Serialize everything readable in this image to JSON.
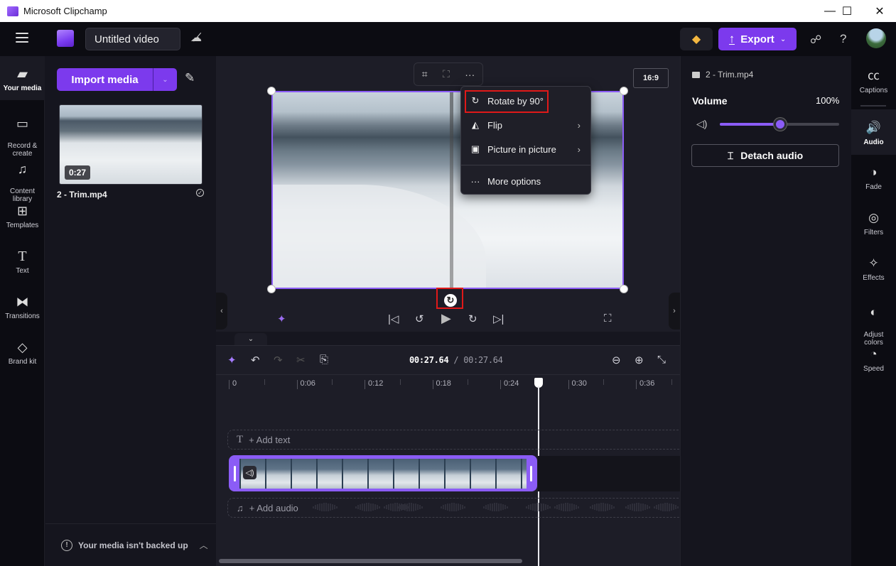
{
  "window": {
    "title": "Microsoft Clipchamp",
    "controls": {
      "minimize": "—",
      "maximize": "☐",
      "close": "✕"
    }
  },
  "appbar": {
    "project_title": "Untitled video",
    "export_label": "Export",
    "icons": {
      "menu": "≡",
      "cloud_off": "☁̸",
      "premium": "◆",
      "share": "☍",
      "help": "?"
    }
  },
  "left_rail": {
    "items": [
      {
        "label": "Your media",
        "icon": "▰",
        "active": true
      },
      {
        "label": "Record &\ncreate",
        "icon": "▭"
      },
      {
        "label": "Content\nlibrary",
        "icon": "♫"
      },
      {
        "label": "Templates",
        "icon": "⊞"
      },
      {
        "label": "Text",
        "icon": "T"
      },
      {
        "label": "Transitions",
        "icon": "⧓"
      },
      {
        "label": "Brand kit",
        "icon": "◇"
      }
    ]
  },
  "media_panel": {
    "import_label": "Import media",
    "items": [
      {
        "name": "2 - Trim.mp4",
        "duration": "0:27",
        "status": "✓"
      }
    ],
    "backup_notice": "Your media isn't backed up"
  },
  "preview": {
    "aspect_ratio": "16:9",
    "toolbar": {
      "crop": "⌗",
      "fit": "⛶",
      "more": "···"
    },
    "context_menu": {
      "items": [
        {
          "label": "Rotate by 90°",
          "icon": "↻",
          "highlighted": true
        },
        {
          "label": "Flip",
          "icon": "◭",
          "submenu": true
        },
        {
          "label": "Picture in picture",
          "icon": "▣",
          "submenu": true
        },
        {
          "label": "More options",
          "icon": "···"
        }
      ]
    },
    "rotate_handle_icon": "↻",
    "playback": {
      "skip_start": "|◁",
      "back5": "↺",
      "play": "▶",
      "fwd5": "↻",
      "skip_end": "▷|",
      "fullscreen": "⛶",
      "ai": "✦"
    }
  },
  "timeline": {
    "current_time": "00:27.64",
    "total_time": "/ 00:27.64",
    "ruler_labels": [
      "0",
      "0:06",
      "0:12",
      "0:18",
      "0:24",
      "0:30",
      "0:36"
    ],
    "playhead_seconds": 27.64,
    "add_text_label": "+ Add text",
    "add_audio_label": "+ Add audio",
    "collapse_icon": "⌄"
  },
  "properties": {
    "file_name": "2 - Trim.mp4",
    "volume_label": "Volume",
    "volume_value": "100%",
    "volume_fraction": 0.5,
    "detach_label": "Detach audio"
  },
  "right_rail": {
    "items": [
      {
        "label": "Captions",
        "icon": "㏄"
      },
      {
        "label": "Audio",
        "icon": "🔊",
        "active": true
      },
      {
        "label": "Fade",
        "icon": "◑"
      },
      {
        "label": "Filters",
        "icon": "◎"
      },
      {
        "label": "Effects",
        "icon": "✧"
      },
      {
        "label": "Adjust\ncolors",
        "icon": "◐"
      },
      {
        "label": "Speed",
        "icon": "◔"
      }
    ]
  },
  "colors": {
    "accent": "#7c3aed",
    "highlight": "#e01919"
  }
}
